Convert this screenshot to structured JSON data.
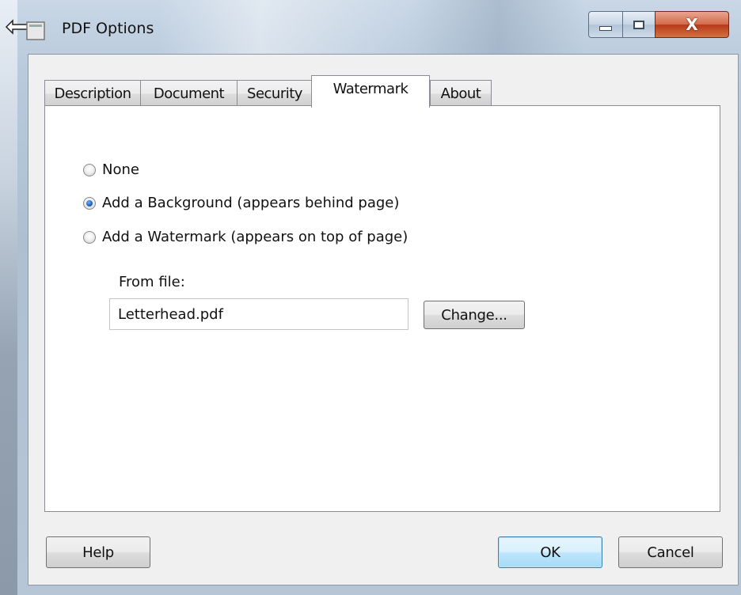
{
  "window": {
    "title": "PDF Options",
    "close_glyph": "X"
  },
  "tabs": [
    {
      "label": "Description",
      "active": false
    },
    {
      "label": "Document",
      "active": false
    },
    {
      "label": "Security",
      "active": false
    },
    {
      "label": "Watermark",
      "active": true
    },
    {
      "label": "About",
      "active": false
    }
  ],
  "watermark": {
    "options": [
      {
        "label": "None",
        "checked": false
      },
      {
        "label": "Add a Background (appears behind page)",
        "checked": true
      },
      {
        "label": "Add a Watermark (appears on top of page)",
        "checked": false
      }
    ],
    "from_file_label": "From file:",
    "file_value": "Letterhead.pdf",
    "change_label": "Change..."
  },
  "footer": {
    "help_label": "Help",
    "ok_label": "OK",
    "cancel_label": "Cancel"
  },
  "colors": {
    "frame": "#b9cadc",
    "client": "#f0f0f0",
    "close_button": "#c4482a",
    "default_button_border": "#3c7fb1"
  }
}
